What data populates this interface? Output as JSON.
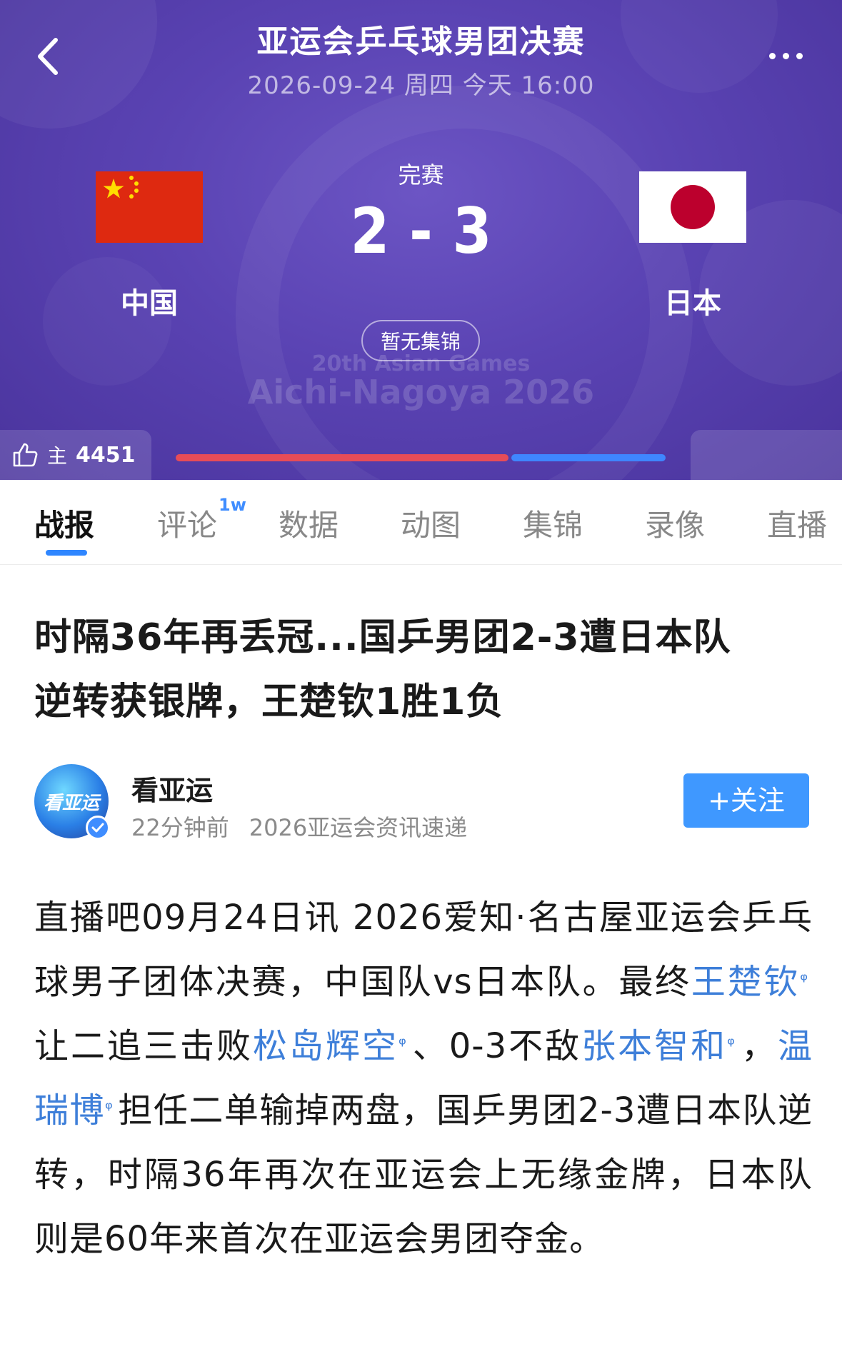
{
  "header": {
    "title": "亚运会乒乓球男团决赛",
    "datetime": "2026-09-24 周四 今天 16:00"
  },
  "match": {
    "status": "完赛",
    "score": "2 - 3",
    "home_team": "中国",
    "away_team": "日本",
    "highlights_label": "暂无集锦",
    "watermark_line1": "20th Asian Games",
    "watermark_line2": "Aichi-Nagoya 2026",
    "support_label": "主",
    "support_count": "4451",
    "home_support_fraction": 0.68,
    "colors": {
      "home_bar": "#e74c57",
      "away_bar": "#3f86ff",
      "hero_bg": "#5a43b3"
    }
  },
  "tabs": [
    {
      "label": "战报"
    },
    {
      "label": "评论",
      "badge": "1w"
    },
    {
      "label": "数据"
    },
    {
      "label": "动图"
    },
    {
      "label": "集锦"
    },
    {
      "label": "录像"
    },
    {
      "label": "直播"
    }
  ],
  "article": {
    "headline_line1": "时隔36年再丢冠...国乒男团2-3遭日本队",
    "headline_line2": "逆转获银牌，王楚钦1胜1负",
    "author": {
      "avatar_text": "看亚运",
      "name": "看亚运",
      "time": "22分钟前",
      "desc": "2026亚运会资讯速递"
    },
    "follow_label": "+关注",
    "body": {
      "p1": "直播吧09月24日讯 2026爱知·名古屋亚运会乒乓球男子团体决赛，中国队vs日本队。最终",
      "link1": "王楚钦",
      "p2": "让二追三击败",
      "link2": "松岛辉空",
      "p3": "、0-3不敌",
      "link3": "张本智和",
      "p4": "，",
      "link4": "温瑞博",
      "p5": "担任二单输掉两盘，国乒男团2-3遭日本队逆转，时隔36年再次在亚运会上无缘金牌，日本队则是60年来首次在亚运会男团夺金。",
      "link_mark": "ᵠ"
    }
  }
}
